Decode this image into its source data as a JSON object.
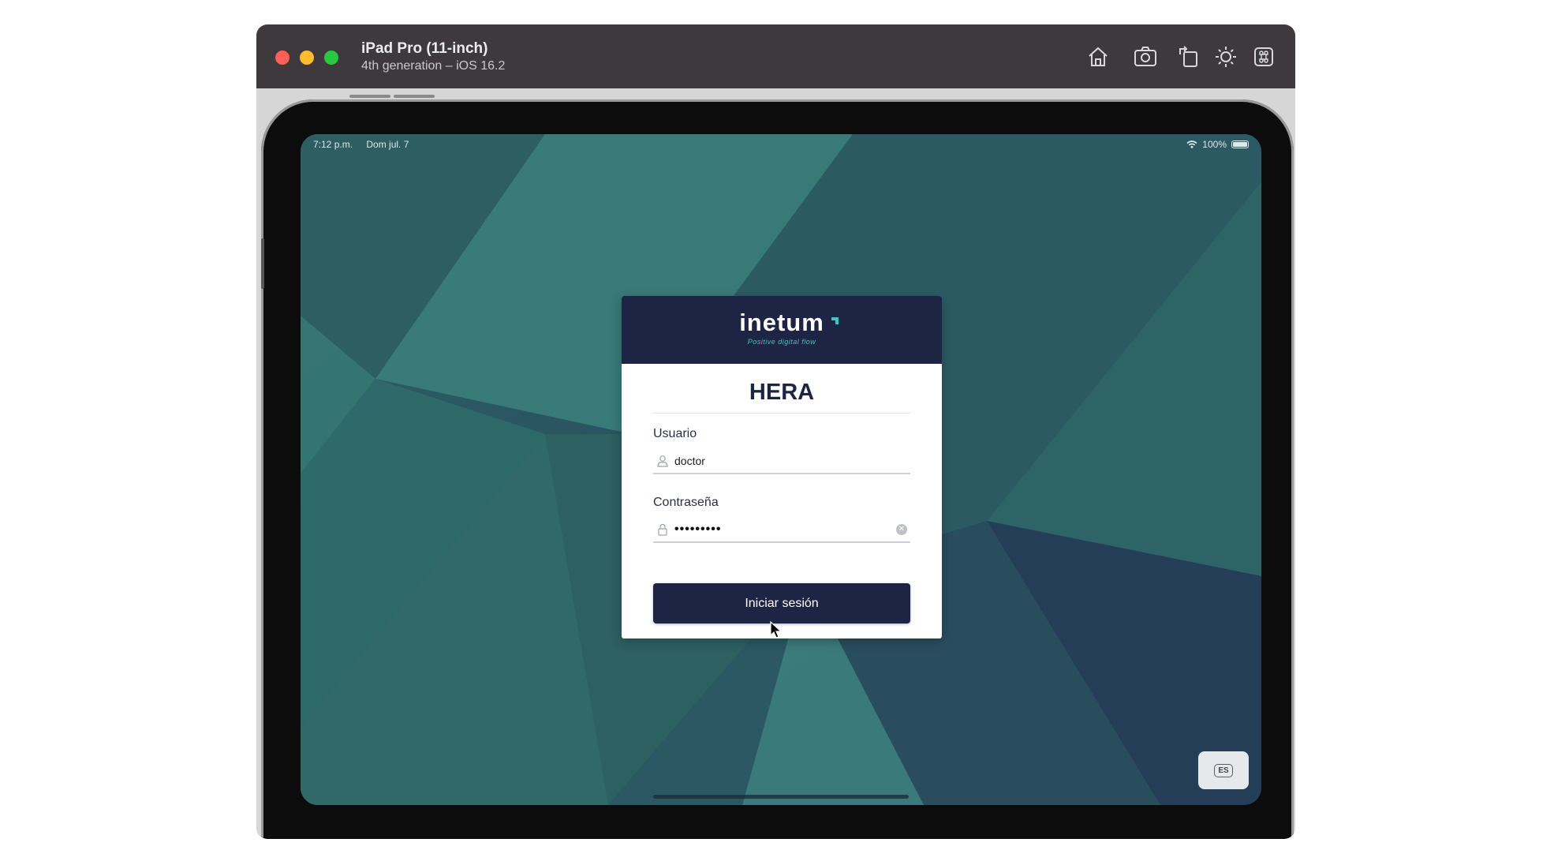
{
  "window": {
    "title": "iPad Pro (11-inch)",
    "subtitle": "4th generation – iOS 16.2",
    "toolbar_icons": [
      "home-icon",
      "screenshot-icon",
      "rotate-icon",
      "brightness-icon",
      "command-icon"
    ]
  },
  "status_bar": {
    "time": "7:12 p.m.",
    "date": "Dom jul. 7",
    "battery": "100%"
  },
  "login": {
    "brand": "inetum",
    "tagline": "Positive digital flow",
    "app_title": "HERA",
    "username_label": "Usuario",
    "username_value": "doctor",
    "password_label": "Contraseña",
    "password_masked": "•••••••••",
    "submit_label": "Iniciar sesión"
  },
  "language_button": "ES",
  "colors": {
    "brand_navy": "#1e2443",
    "brand_teal": "#3ec7c0",
    "background_teal": "#2c5a64"
  }
}
